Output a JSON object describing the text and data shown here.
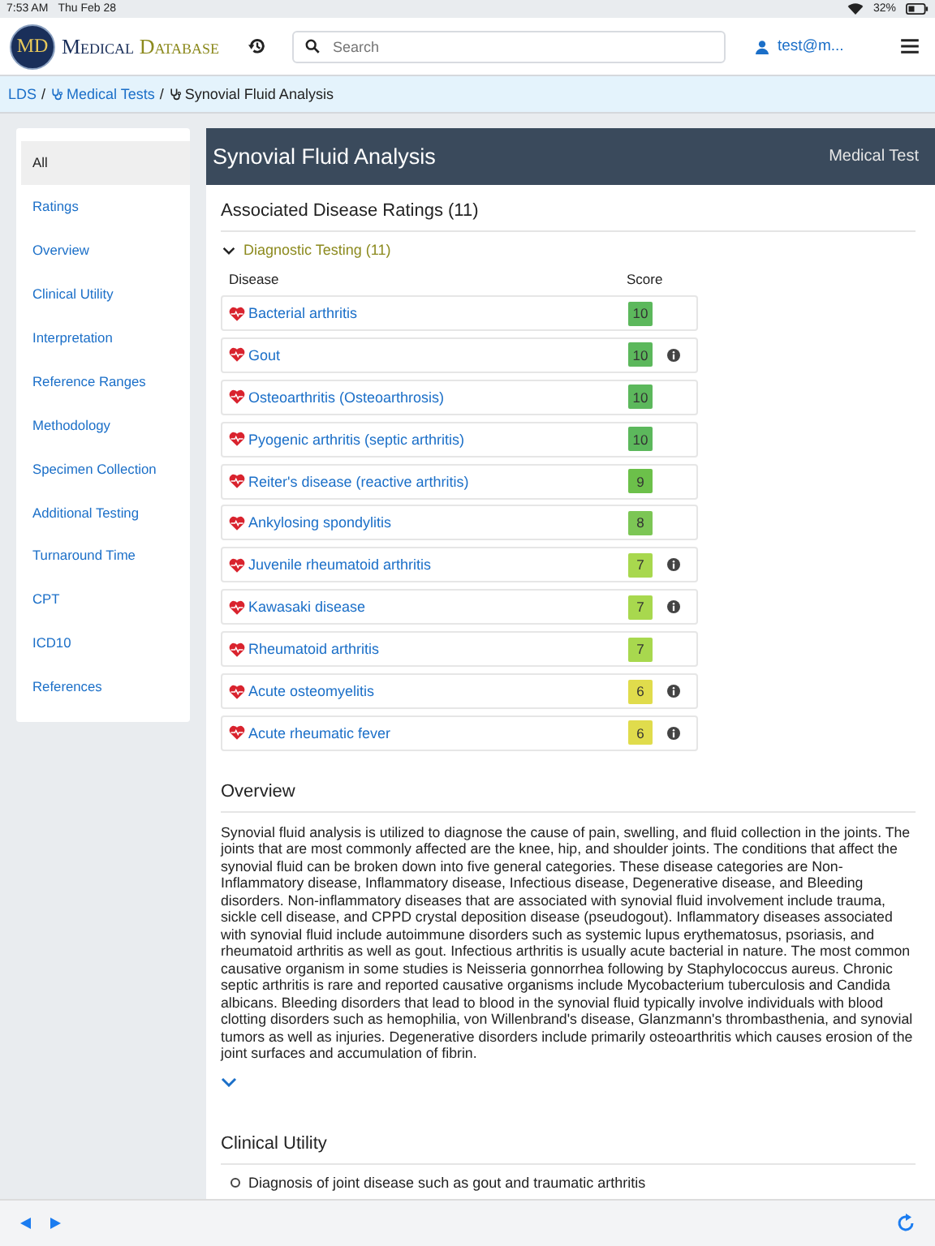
{
  "status_bar": {
    "time": "7:53 AM",
    "date": "Thu Feb 28",
    "battery": "32%"
  },
  "header": {
    "logo_mark": "MD",
    "logo_word_1": "Medical",
    "logo_word_2": "Database",
    "search": {
      "placeholder": "Search"
    },
    "user": "test@m..."
  },
  "breadcrumb": [
    {
      "label": "LDS",
      "icon": false,
      "link": true
    },
    {
      "separator": "/",
      "label": "Medical Tests",
      "icon": true,
      "link": true
    },
    {
      "separator": "/",
      "label": "Synovial Fluid Analysis",
      "icon": true,
      "link": false
    }
  ],
  "sidebar": {
    "items": [
      {
        "label": "All",
        "selected": true
      },
      {
        "label": "Ratings",
        "selected": false
      },
      {
        "label": "Overview",
        "selected": false
      },
      {
        "label": "Clinical Utility",
        "selected": false
      },
      {
        "label": "Interpretation",
        "selected": false
      },
      {
        "label": "Reference Ranges",
        "selected": false
      },
      {
        "label": "Methodology",
        "selected": false
      },
      {
        "label": "Specimen Collection",
        "selected": false
      },
      {
        "label": "Additional Testing",
        "selected": false
      },
      {
        "label": "Turnaround Time",
        "selected": false
      },
      {
        "label": "CPT",
        "selected": false
      },
      {
        "label": "ICD10",
        "selected": false
      },
      {
        "label": "References",
        "selected": false
      }
    ]
  },
  "panel": {
    "title": "Synovial Fluid Analysis",
    "type": "Medical Test"
  },
  "ratings": {
    "heading": "Associated Disease Ratings (11)",
    "group": {
      "label": "Diagnostic Testing (11)",
      "expanded": true
    },
    "columns": [
      "Disease",
      "Score"
    ],
    "rows": [
      {
        "disease": "Bacterial arthritis",
        "score": "10",
        "color": "#5cb85c",
        "info": false
      },
      {
        "disease": "Gout",
        "score": "10",
        "color": "#5cb85c",
        "info": true
      },
      {
        "disease": "Osteoarthritis (Osteoarthrosis)",
        "score": "10",
        "color": "#5cb85c",
        "info": false
      },
      {
        "disease": "Pyogenic arthritis (septic arthritis)",
        "score": "10",
        "color": "#5cb85c",
        "info": false
      },
      {
        "disease": "Reiter's disease (reactive arthritis)",
        "score": "9",
        "color": "#6cc04a",
        "info": false
      },
      {
        "disease": "Ankylosing spondylitis",
        "score": "8",
        "color": "#7cc655",
        "info": false
      },
      {
        "disease": "Juvenile rheumatoid arthritis",
        "score": "7",
        "color": "#a8d84e",
        "info": true
      },
      {
        "disease": "Kawasaki disease",
        "score": "7",
        "color": "#a8d84e",
        "info": true
      },
      {
        "disease": "Rheumatoid arthritis",
        "score": "7",
        "color": "#a8d84e",
        "info": false
      },
      {
        "disease": "Acute osteomyelitis",
        "score": "6",
        "color": "#e0dc4c",
        "info": true
      },
      {
        "disease": "Acute rheumatic fever",
        "score": "6",
        "color": "#e0dc4c",
        "info": true
      }
    ]
  },
  "overview": {
    "heading": "Overview",
    "text": "Synovial fluid analysis is utilized to diagnose the cause of pain, swelling, and fluid collection in the joints. The joints that are most commonly affected are the knee, hip, and shoulder joints. The conditions that affect the synovial fluid can be broken down into five general categories. These disease categories are Non-Inflammatory disease, Inflammatory disease, Infectious disease, Degenerative disease, and Bleeding disorders. Non-inflammatory diseases that are associated with synovial fluid involvement include trauma, sickle cell disease, and CPPD crystal deposition disease (pseudogout). Inflammatory diseases associated with synovial fluid include autoimmune disorders such as systemic lupus erythematosus, psoriasis, and rheumatoid arthritis as well as gout. Infectious arthritis is usually acute bacterial in nature. The most common causative organism in some studies is Neisseria gonnorrhea following by Staphylococcus aureus. Chronic septic arthritis is rare and reported causative organisms include Mycobacterium tuberculosis and Candida albicans. Bleeding disorders that lead to blood in the synovial fluid typically involve individuals with blood clotting disorders such as hemophilia, von Willenbrand's disease, Glanzmann's thrombasthenia, and synovial tumors as well as injuries. Degenerative disorders include primarily osteoarthritis which causes erosion of the joint surfaces and accumulation of fibrin.",
    "expanded": false
  },
  "clinical_utility": {
    "heading": "Clinical Utility",
    "items": [
      "Diagnosis of joint disease such as gout and traumatic arthritis"
    ]
  }
}
